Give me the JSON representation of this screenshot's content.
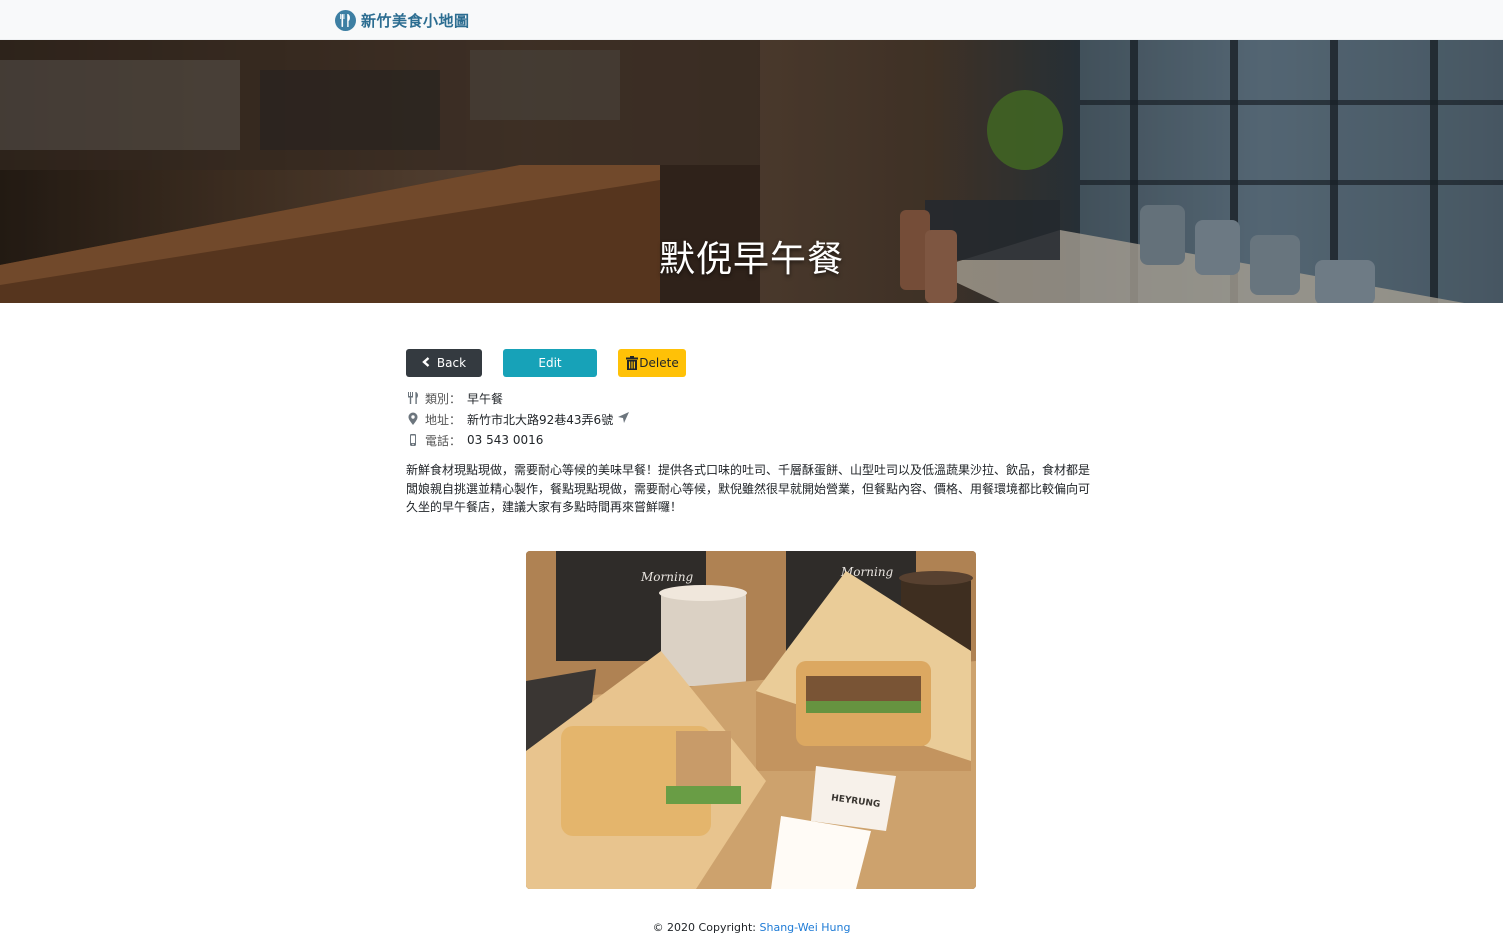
{
  "navbar": {
    "brand": "新竹美食小地圖",
    "brand_icon": "utensils-icon"
  },
  "hero": {
    "title": "默倪早午餐"
  },
  "actions": {
    "back_label": "Back",
    "edit_label": "Edit",
    "delete_label": "Delete"
  },
  "details": {
    "category_label": "類別：",
    "category_value": "早午餐",
    "address_label": "地址：",
    "address_value": "新竹市北大路92巷43弄6號",
    "phone_label": "電話：",
    "phone_value": "03 543 0016"
  },
  "description": "新鮮食材現點現做，需要耐心等候的美味早餐！提供各式口味的吐司、千層酥蛋餅、山型吐司以及低溫蔬果沙拉、飲品，食材都是闆娘親自挑選並精心製作，餐點現點現做，需要耐心等候，默倪雖然很早就開始營業，但餐點內容、價格、用餐環境都比較偏向可久坐的早午餐店，建議大家有多點時間再來嘗鮮囉！",
  "photo": {
    "sign_text": "HEYRUNG",
    "bag_text": "Morning"
  },
  "footer": {
    "copyright": "© 2020 Copyright: ",
    "author": "Shang-Wei Hung"
  },
  "colors": {
    "navbar_bg": "#f8f9fa",
    "brand": "#2c6d91",
    "back_btn": "#343a40",
    "edit_btn": "#17a2b8",
    "delete_btn": "#ffc107",
    "link": "#1e7bd6"
  }
}
